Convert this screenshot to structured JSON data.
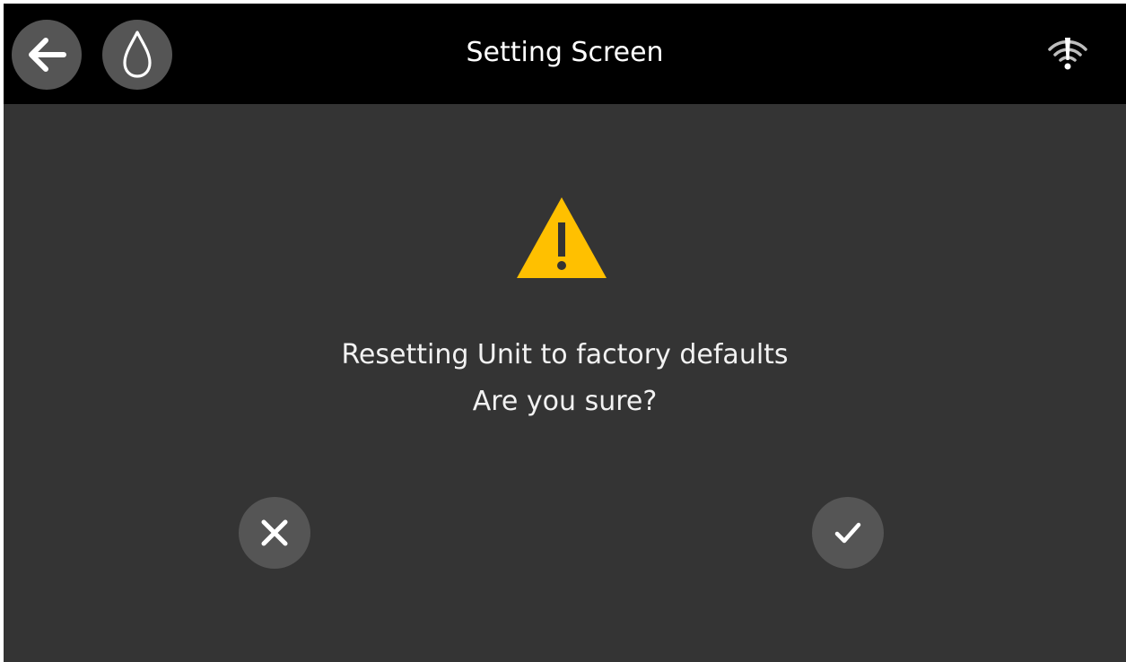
{
  "header": {
    "title": "Setting Screen",
    "back_icon": "arrow-left-icon",
    "flame_icon": "flame-icon",
    "status_icon": "wifi-warning-icon"
  },
  "dialog": {
    "icon": "warning-triangle-icon",
    "message_line1": "Resetting Unit to factory defaults",
    "message_line2": "Are you sure?",
    "cancel_icon": "close-icon",
    "confirm_icon": "check-icon"
  },
  "colors": {
    "background": "#343434",
    "header_background": "#000000",
    "button_fill": "#555555",
    "warning": "#FFC000",
    "text": "#FFFFFF"
  }
}
